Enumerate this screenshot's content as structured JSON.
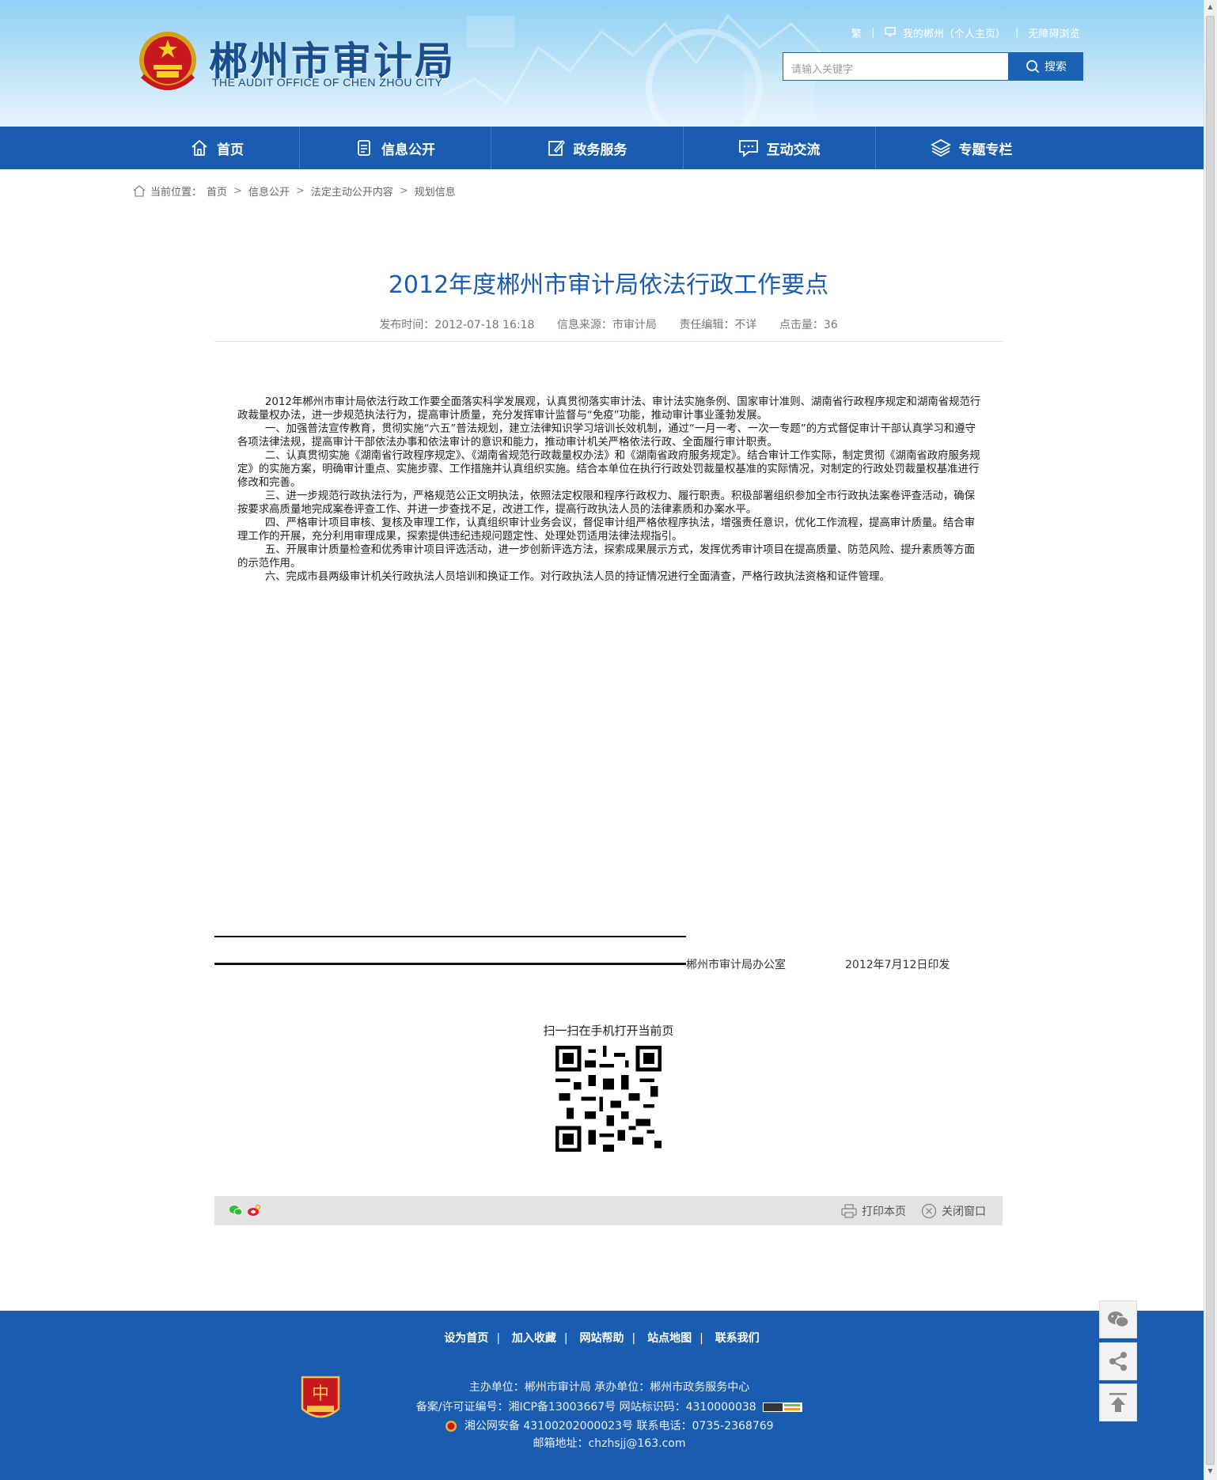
{
  "header": {
    "site_title": "郴州市审计局",
    "site_subtitle": "THE AUDIT OFFICE OF CHEN ZHOU CITY",
    "top_links": {
      "traditional": "繁",
      "my_chenzhou": "我的郴州（个人主页）",
      "accessible": "无障碍浏览"
    },
    "search": {
      "placeholder": "请输入关键字",
      "button": "搜索"
    }
  },
  "nav": {
    "items": [
      {
        "label": "首页",
        "icon": "home-icon"
      },
      {
        "label": "信息公开",
        "icon": "document-icon"
      },
      {
        "label": "政务服务",
        "icon": "edit-icon"
      },
      {
        "label": "互动交流",
        "icon": "chat-icon"
      },
      {
        "label": "专题专栏",
        "icon": "layers-icon"
      }
    ]
  },
  "breadcrumb": {
    "prefix": "当前位置：",
    "items": [
      "首页",
      "信息公开",
      "法定主动公开内容",
      "规划信息"
    ]
  },
  "article": {
    "title": "2012年度郴州市审计局依法行政工作要点",
    "meta": {
      "publish_time": "发布时间：2012-07-18 16:18",
      "source": "信息来源：市审计局",
      "editor": "责任编辑：不详",
      "views": "点击量：36"
    },
    "paragraphs": [
      "2012年郴州市审计局依法行政工作要全面落实科学发展观，认真贯彻落实审计法、审计法实施条例、国家审计准则、湖南省行政程序规定和湖南省规范行政裁量权办法，进一步规范执法行为，提高审计质量，充分发挥审计监督与“免疫”功能，推动审计事业蓬勃发展。",
      "一、加强普法宣传教育，贯彻实施“六五”普法规划，建立法律知识学习培训长效机制，通过“一月一考、一次一专题”的方式督促审计干部认真学习和遵守各项法律法规，提高审计干部依法办事和依法审计的意识和能力，推动审计机关严格依法行政、全面履行审计职责。",
      "二、认真贯彻实施《湖南省行政程序规定》、《湖南省规范行政裁量权办法》和《湖南省政府服务规定》。结合审计工作实际，制定贯彻《湖南省政府服务规定》的实施方案，明确审计重点、实施步骤、工作措施并认真组织实施。结合本单位在执行行政处罚裁量权基准的实际情况，对制定的行政处罚裁量权基准进行修改和完善。",
      "三、进一步规范行政执法行为，严格规范公正文明执法，依照法定权限和程序行政权力、履行职责。积极部署组织参加全市行政执法案卷评查活动，确保按要求高质量地完成案卷评查工作、并进一步查找不足，改进工作，提高行政执法人员的法律素质和办案水平。",
      "四、严格审计项目审核、复核及审理工作，认真组织审计业务会议，督促审计组严格依程序执法，增强责任意识，优化工作流程，提高审计质量。结合审理工作的开展，充分利用审理成果，探索提供违纪违规问题定性、处理处罚适用法律法规指引。",
      "五、开展审计质量检查和优秀审计项目评选活动，进一步创新评选方法，探索成果展示方式，发挥优秀审计项目在提高质量、防范风险、提升素质等方面的示范作用。",
      "六、完成市县两级审计机关行政执法人员培训和换证工作。对行政执法人员的持证情况进行全面清查，严格行政执法资格和证件管理。"
    ],
    "signature_org": "郴州市审计局办公室",
    "signature_date": "2012年7月12日印发",
    "qr_caption": "扫一扫在手机打开当前页"
  },
  "share_bar": {
    "print": "打印本页",
    "close": "关闭窗口"
  },
  "footer": {
    "links": [
      "设为首页",
      "加入收藏",
      "网站帮助",
      "站点地图",
      "联系我们"
    ],
    "host": "主办单位：郴州市审计局   承办单位：郴州市政务服务中心",
    "icp": "备案/许可证编号：湘ICP备13003667号   网站标识码：4310000038",
    "police": "湘公网安备 43100202000023号   联系电话：0735-2368769",
    "email": "邮箱地址：chzhsjj@163.com"
  },
  "colors": {
    "brand_blue": "#1a5db0",
    "title_blue": "#1a5db0",
    "header_sky": "#8fd0f3"
  }
}
